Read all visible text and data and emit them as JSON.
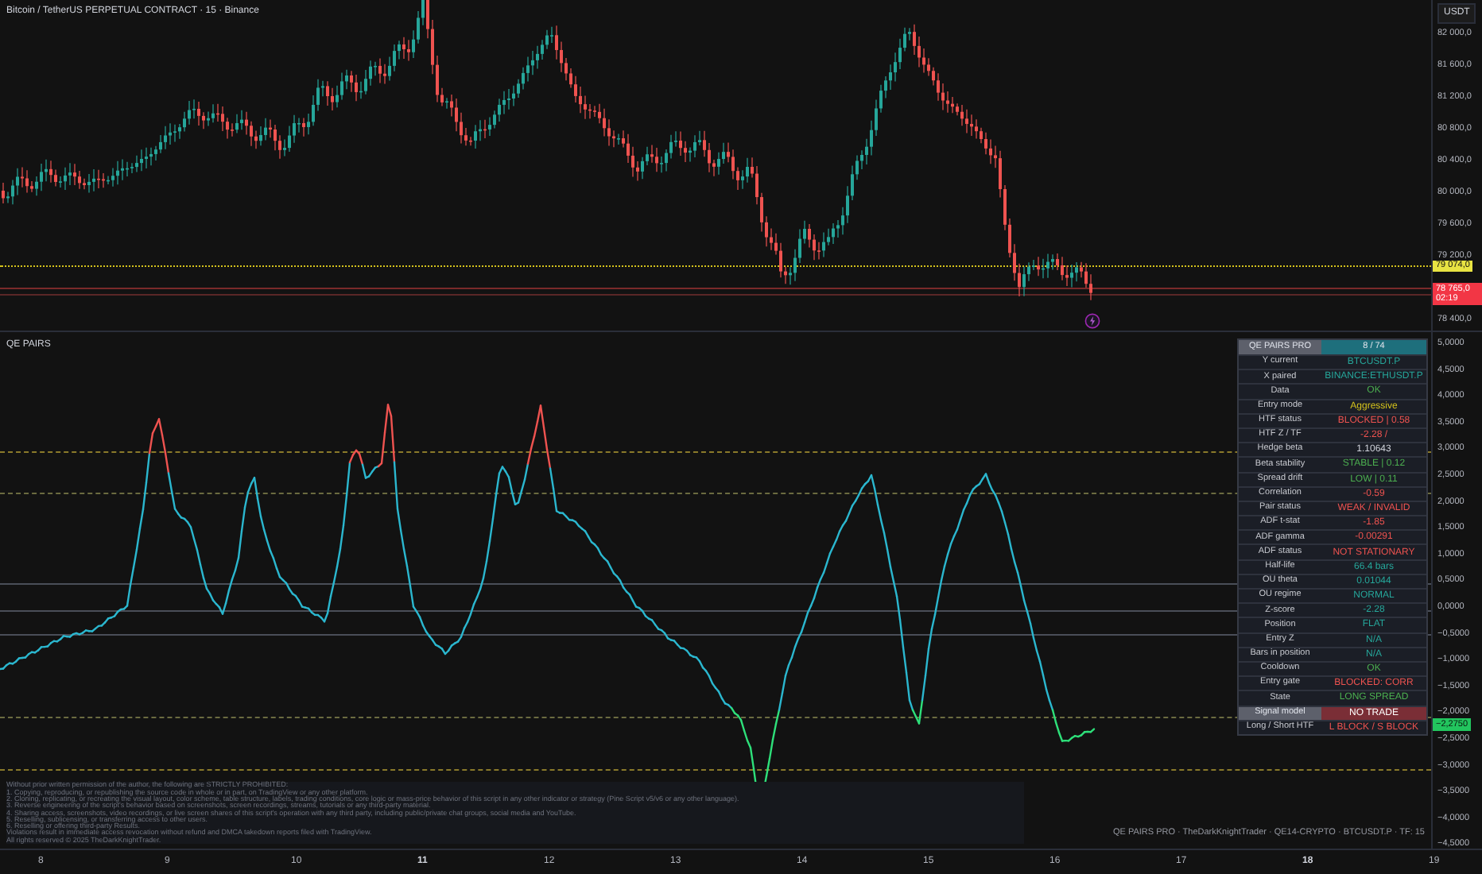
{
  "header": {
    "title": "Bitcoin / TetherUS PERPETUAL CONTRACT · 15 · Binance"
  },
  "price_axis": {
    "currency": "USDT",
    "ticks": [
      "82 000,0",
      "81 600,0",
      "81 200,0",
      "80 800,0",
      "80 400,0",
      "80 000,0",
      "79 600,0",
      "79 200,0",
      "78 400,0"
    ],
    "last_price": "79 074,0",
    "countdown_price": "78 765,0",
    "countdown": "02:19"
  },
  "indicator": {
    "name": "QE PAIRS",
    "axis_ticks": [
      "5,0000",
      "4,5000",
      "4,0000",
      "3,5000",
      "3,0000",
      "2,5000",
      "2,0000",
      "1,5000",
      "1,0000",
      "0,5000",
      "0,0000",
      "−0,5000",
      "−1,0000",
      "−1,5000",
      "−2,0000",
      "−2,5000",
      "−3,0000",
      "−3,5000",
      "−4,0000",
      "−4,5000"
    ],
    "current_value": "−2,2750",
    "table": {
      "title": "QE PAIRS PRO",
      "count": "8 / 74",
      "rows": [
        {
          "kind": "row",
          "label": "Y current",
          "value": "BTCUSDT.P",
          "color": "#26a69a"
        },
        {
          "kind": "row",
          "label": "X paired",
          "value": "BINANCE:ETHUSDT.P",
          "color": "#26a69a"
        },
        {
          "kind": "row",
          "label": "Data",
          "value": "OK",
          "color": "#4caf50"
        },
        {
          "kind": "row",
          "label": "Entry mode",
          "value": "Aggressive",
          "color": "#d4c21c"
        },
        {
          "kind": "row",
          "label": "HTF status",
          "value": "BLOCKED | 0.58",
          "color": "#ef5350"
        },
        {
          "kind": "row",
          "label": "HTF Z / TF",
          "value": "-2.28 /",
          "color": "#ef5350"
        },
        {
          "kind": "row",
          "label": "Hedge beta",
          "value": "1.10643",
          "color": "#d1d4dc"
        },
        {
          "kind": "row",
          "label": "Beta stability",
          "value": "STABLE | 0.12",
          "color": "#4caf50"
        },
        {
          "kind": "row",
          "label": "Spread drift",
          "value": "LOW | 0.11",
          "color": "#4caf50"
        },
        {
          "kind": "row",
          "label": "Correlation",
          "value": "-0.59",
          "color": "#ef5350"
        },
        {
          "kind": "row",
          "label": "Pair status",
          "value": "WEAK / INVALID",
          "color": "#ef5350"
        },
        {
          "kind": "row",
          "label": "ADF t-stat",
          "value": "-1.85",
          "color": "#ef5350"
        },
        {
          "kind": "row",
          "label": "ADF gamma",
          "value": "-0.00291",
          "color": "#ef5350"
        },
        {
          "kind": "row",
          "label": "ADF status",
          "value": "NOT STATIONARY",
          "color": "#ef5350"
        },
        {
          "kind": "row",
          "label": "Half-life",
          "value": "66.4 bars",
          "color": "#26a69a"
        },
        {
          "kind": "row",
          "label": "OU theta",
          "value": "0.01044",
          "color": "#26a69a"
        },
        {
          "kind": "row",
          "label": "OU regime",
          "value": "NORMAL",
          "color": "#26a69a"
        },
        {
          "kind": "row",
          "label": "Z-score",
          "value": "-2.28",
          "color": "#26a69a"
        },
        {
          "kind": "row",
          "label": "Position",
          "value": "FLAT",
          "color": "#26a69a"
        },
        {
          "kind": "row",
          "label": "Entry Z",
          "value": "N/A",
          "color": "#26a69a"
        },
        {
          "kind": "row",
          "label": "Bars in position",
          "value": "N/A",
          "color": "#26a69a"
        },
        {
          "kind": "row",
          "label": "Cooldown",
          "value": "OK",
          "color": "#4caf50"
        },
        {
          "kind": "row",
          "label": "Entry gate",
          "value": "BLOCKED: CORR",
          "color": "#ef5350"
        },
        {
          "kind": "row",
          "label": "State",
          "value": "LONG SPREAD",
          "color": "#4caf50"
        },
        {
          "kind": "signal",
          "label": "Signal model",
          "value": "NO TRADE"
        },
        {
          "kind": "row",
          "label": "Long / Short HTF",
          "value": "L BLOCK / S BLOCK",
          "color": "#ef5350"
        }
      ]
    },
    "disclaimer": [
      "Without prior written permission of the author, the following are STRICTLY PROHIBITED:",
      "1. Copying, reproducing, or republishing the source code in whole or in part, on TradingView or any other platform.",
      "2. Cloning, replicating, or recreating the visual layout, color scheme, table structure, labels, trading conditions, core logic or mass-price behavior of this script in any other indicator or strategy (Pine Script v5/v6 or any other language).",
      "3. Reverse engineering of the script's behavior based on screenshots, screen recordings, streams, tutorials or any third-party material.",
      "4. Sharing access, screenshots, video recordings, or live screen shares of this script's operation with any third party, including public/private chat groups, social media and YouTube.",
      "5. Reselling, sublicensing, or transferring access to other users.",
      "6. Reselling or offering third-party Results.",
      "Violations result in immediate access revocation without refund and DMCA takedown reports filed with TradingView.",
      "All rights reserved © 2025 TheDarkKnightTrader."
    ],
    "footer": "QE PAIRS PRO · TheDarkKnightTrader · QE14-CRYPTO · BTCUSDT.P · TF: 15"
  },
  "time_axis": [
    {
      "label": "8",
      "bold": false
    },
    {
      "label": "9",
      "bold": false
    },
    {
      "label": "10",
      "bold": false
    },
    {
      "label": "11",
      "bold": true
    },
    {
      "label": "12",
      "bold": false
    },
    {
      "label": "13",
      "bold": false
    },
    {
      "label": "14",
      "bold": false
    },
    {
      "label": "15",
      "bold": false
    },
    {
      "label": "16",
      "bold": false
    },
    {
      "label": "17",
      "bold": false
    },
    {
      "label": "18",
      "bold": true
    },
    {
      "label": "19",
      "bold": false
    }
  ]
}
